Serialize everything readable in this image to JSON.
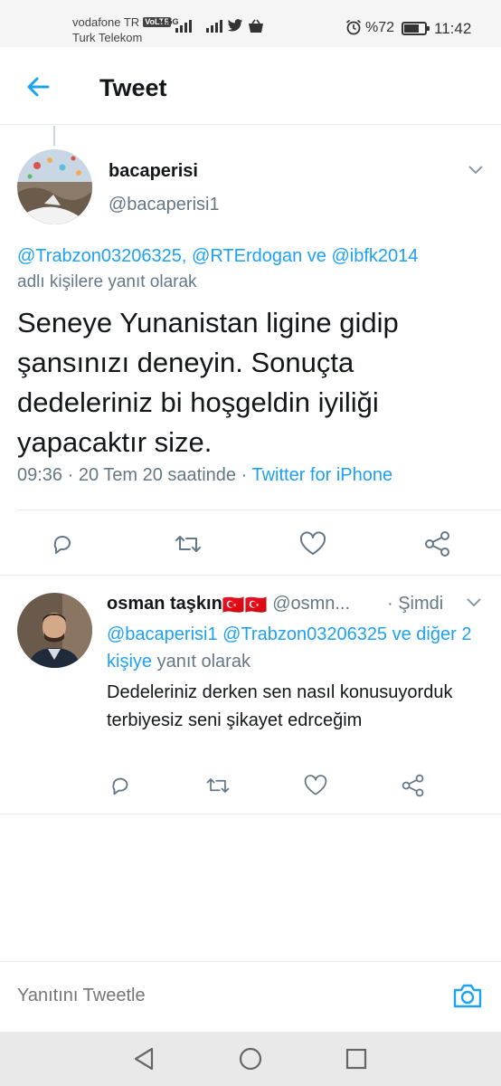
{
  "status_bar": {
    "carrier1": "vodafone TR",
    "volte": "VoLTE",
    "carrier2": "Turk Telekom",
    "network1": "4.5G",
    "battery_percent": "%72",
    "battery_level": 0.72,
    "time": "11:42"
  },
  "header": {
    "title": "Tweet"
  },
  "tweet": {
    "display_name": "bacaperisi",
    "handle": "@bacaperisi1",
    "reply_to_mentions": "@Trabzon03206325, @RTErdogan ve @ibfk2014",
    "reply_to_suffix": "adlı kişilere yanıt olarak",
    "text": "Seneye Yunanistan ligine gidip şansınızı deneyin. Sonuçta dedeleriniz bi hoşgeldin iyiliği yapacaktır size.",
    "time": "09:36",
    "date": "20 Tem 20 saatinde",
    "source": "Twitter for iPhone"
  },
  "reply": {
    "display_name": "osman taşkın",
    "flags": "🇹🇷🇹🇷",
    "handle": "@osmn...",
    "time": "Şimdi",
    "reply_to_mentions": "@bacaperisi1 @Trabzon03206325 ve diğer 2 kişiye",
    "reply_to_suffix": "yanıt olarak",
    "text": "Dedeleriniz derken sen nasıl konusuyorduk terbiyesiz seni şikayet edrceğim"
  },
  "compose": {
    "placeholder": "Yanıtını Tweetle"
  },
  "colors": {
    "accent": "#1da1f2",
    "secondary_text": "#657786",
    "divider": "#e6ecf0"
  },
  "icons": [
    "back-arrow-icon",
    "chevron-down-icon",
    "reply-icon",
    "retweet-icon",
    "like-icon",
    "share-icon",
    "camera-icon",
    "nav-back-icon",
    "nav-home-icon",
    "nav-recents-icon"
  ]
}
